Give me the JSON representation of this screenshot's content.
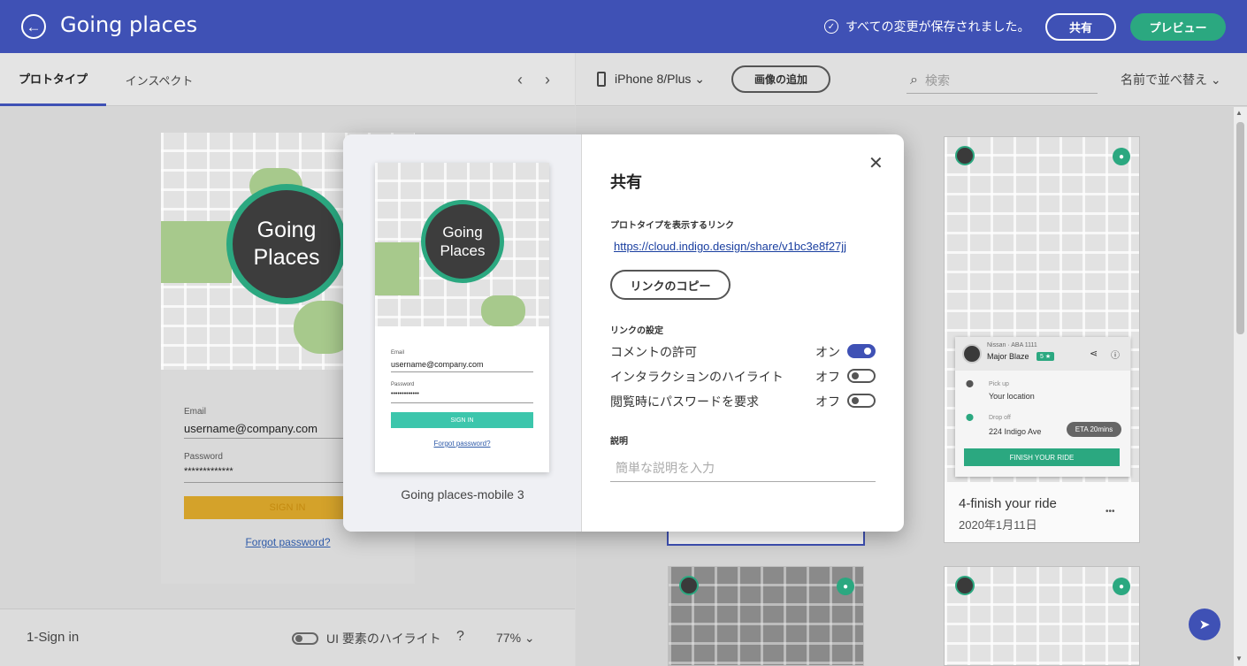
{
  "header": {
    "title": "Going places",
    "saved_status": "すべての変更が保存されました。",
    "share_label": "共有",
    "preview_label": "プレビュー",
    "back_icon": "arrow-left-icon"
  },
  "left_panel": {
    "tabs": [
      {
        "label": "プロトタイプ"
      },
      {
        "label": "インスペクト"
      }
    ],
    "phone": {
      "logo_line1": "Going",
      "logo_line2": "Places",
      "email_label": "Email",
      "email_value": "username@company.com",
      "password_label": "Password",
      "password_value": "*************",
      "signin_label": "SIGN IN",
      "forgot_label": "Forgot password?"
    },
    "footer": {
      "screen_name": "1-Sign in",
      "ui_highlight_label": "UI 要素のハイライト",
      "help": "?",
      "zoom": "77%"
    }
  },
  "right_panel": {
    "device": "iPhone 8/Plus",
    "add_image_label": "画像の追加",
    "search_placeholder": "検索",
    "sort_label": "名前で並べ替え",
    "cards": [
      {
        "title": "4-finish your ride",
        "date": "2020年1月11日",
        "more": "•••",
        "driver_car": "Nissan · ABA 1111",
        "driver_name": "Major Blaze",
        "driver_rating": "5 ★",
        "pickup_label": "Pick up",
        "pickup_value": "Your location",
        "dropoff_label": "Drop off",
        "dropoff_value": "224 Indigo Ave",
        "eta": "ETA 20mins",
        "finish_label": "FINISH YOUR RIDE"
      }
    ]
  },
  "modal": {
    "title": "共有",
    "link_section_label": "プロトタイプを表示するリンク",
    "url": "https://cloud.indigo.design/share/v1bc3e8f27jj",
    "copy_label": "リンクのコピー",
    "settings_label": "リンクの設定",
    "settings": [
      {
        "label": "コメントの許可",
        "value": "オン",
        "on": true
      },
      {
        "label": "インタラクションのハイライト",
        "value": "オフ",
        "on": false
      },
      {
        "label": "閲覧時にパスワードを要求",
        "value": "オフ",
        "on": false
      }
    ],
    "description_label": "説明",
    "description_placeholder": "簡単な説明を入力",
    "thumbnail_caption": "Going places-mobile 3",
    "thumb": {
      "logo_line1": "Going",
      "logo_line2": "Places",
      "email_label": "Email",
      "email_value": "username@company.com",
      "password_label": "Password",
      "password_value": "•••••••••••••",
      "signin_label": "SIGN IN",
      "forgot_label": "Forgot password?"
    }
  },
  "colors": {
    "primary": "#3f51b5",
    "accent": "#2ba880",
    "signin_yellow": "#d4a22a"
  }
}
